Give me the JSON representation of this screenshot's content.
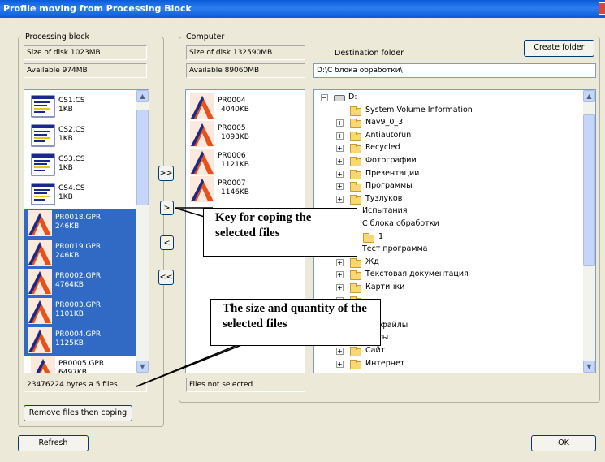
{
  "window": {
    "title": "Profile moving from Processing Block"
  },
  "processing": {
    "legend": "Processing block",
    "disk_size": "Size of disk 1023MB",
    "available": "Available 974MB",
    "files": [
      {
        "name": "CS1.CS",
        "size": "1KB",
        "type": "cs",
        "selected": false
      },
      {
        "name": "CS2.CS",
        "size": "1KB",
        "type": "cs",
        "selected": false
      },
      {
        "name": "CS3.CS",
        "size": "1KB",
        "type": "cs",
        "selected": false
      },
      {
        "name": "CS4.CS",
        "size": "1KB",
        "type": "cs",
        "selected": false
      },
      {
        "name": "PR0018.GPR",
        "size": "246KB",
        "type": "gpr",
        "selected": true
      },
      {
        "name": "PR0019.GPR",
        "size": "246KB",
        "type": "gpr",
        "selected": true
      },
      {
        "name": "PR0002.GPR",
        "size": "4764KB",
        "type": "gpr",
        "selected": true
      },
      {
        "name": "PR0003.GPR",
        "size": "1101KB",
        "type": "gpr",
        "selected": true
      },
      {
        "name": "PR0004.GPR",
        "size": "1125KB",
        "type": "gpr",
        "selected": true
      },
      {
        "name": "PR0005.GPR",
        "size": "6497KB",
        "type": "gpr",
        "selected": false
      }
    ],
    "status": "23476224 bytes a 5 files",
    "remove_label": "Remove files then coping"
  },
  "transfer": {
    "copy_all": ">>",
    "copy": ">",
    "back": "<",
    "back_all": "<<"
  },
  "computer": {
    "legend": "Computer",
    "disk_size": "Size of disk 132590MB",
    "available": "Available 89060MB",
    "dest_label": "Destination folder",
    "create_folder_label": "Create folder",
    "dest_path": "D:\\С блока обработки\\",
    "files": [
      {
        "name": "PR0004",
        "size": "4040KB"
      },
      {
        "name": "PR0005",
        "size": "1093KB"
      },
      {
        "name": "PR0006",
        "size": "1121KB"
      },
      {
        "name": "PR0007",
        "size": "1146KB"
      }
    ],
    "status": "Files not selected"
  },
  "tree": [
    {
      "label": "D:",
      "level": 0,
      "expander": "−",
      "icon": "drive"
    },
    {
      "label": "System Volume Information",
      "level": 1,
      "expander": "",
      "icon": "folder"
    },
    {
      "label": "Nav9_0_3",
      "level": 1,
      "expander": "+",
      "icon": "folder"
    },
    {
      "label": "Antiautorun",
      "level": 1,
      "expander": "+",
      "icon": "folder"
    },
    {
      "label": "Recycled",
      "level": 1,
      "expander": "+",
      "icon": "folder"
    },
    {
      "label": "Фотографии",
      "level": 1,
      "expander": "+",
      "icon": "folder"
    },
    {
      "label": "Презентации",
      "level": 1,
      "expander": "+",
      "icon": "folder"
    },
    {
      "label": "Программы",
      "level": 1,
      "expander": "+",
      "icon": "folder"
    },
    {
      "label": "Тузлуков",
      "level": 1,
      "expander": "+",
      "icon": "folder"
    },
    {
      "label": "Испытания",
      "level": 1,
      "expander": "",
      "icon": "none"
    },
    {
      "label": "С блока обработки",
      "level": 1,
      "expander": "",
      "icon": "none"
    },
    {
      "label": "1",
      "level": 2,
      "expander": "",
      "icon": "folder"
    },
    {
      "label": "Тест программа",
      "level": 1,
      "expander": "",
      "icon": "none"
    },
    {
      "label": "Жд",
      "level": 1,
      "expander": "+",
      "icon": "folder"
    },
    {
      "label": "Текстовая документация",
      "level": 1,
      "expander": "+",
      "icon": "folder"
    },
    {
      "label": "Картинки",
      "level": 1,
      "expander": "+",
      "icon": "folder"
    },
    {
      "label": "",
      "level": 1,
      "expander": "+",
      "icon": "folder"
    },
    {
      "label": "ка",
      "level": 1,
      "expander": "",
      "icon": "none"
    },
    {
      "label": "ные файлы",
      "level": 1,
      "expander": "",
      "icon": "none"
    },
    {
      "label": "менты",
      "level": 1,
      "expander": "",
      "icon": "none"
    },
    {
      "label": "Сайт",
      "level": 1,
      "expander": "+",
      "icon": "folder"
    },
    {
      "label": "Интернет",
      "level": 1,
      "expander": "+",
      "icon": "folder"
    }
  ],
  "callouts": {
    "copy_key": "Key for coping the selected files",
    "size_qty": "The size and quantity of the selected files"
  },
  "footer": {
    "refresh_label": "Refresh",
    "ok_label": "OK"
  }
}
